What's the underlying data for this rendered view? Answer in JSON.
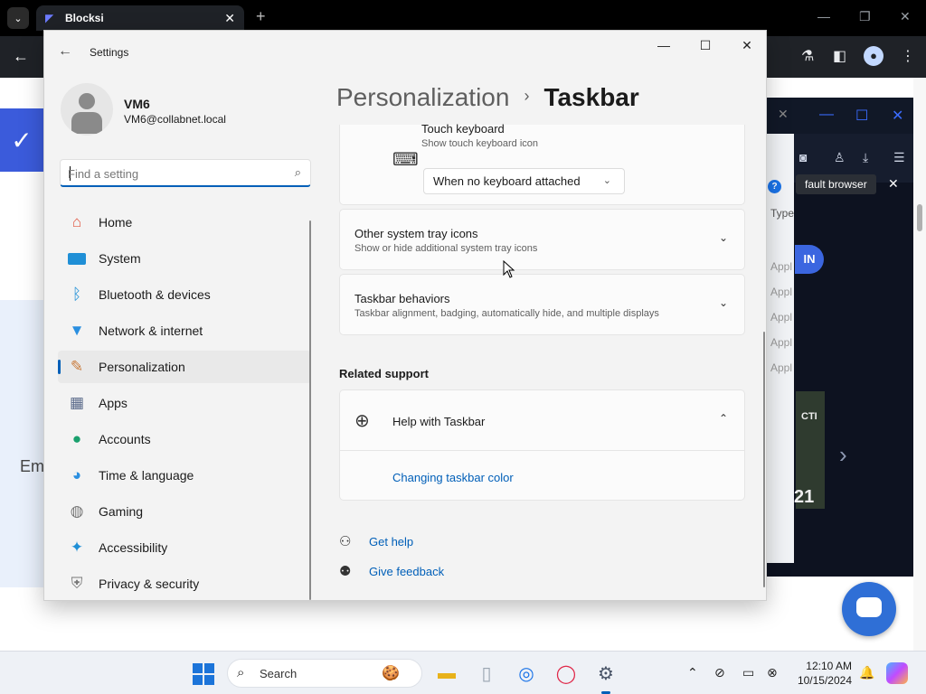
{
  "browser": {
    "tab_title": "Blocksi",
    "tab_close": "✕",
    "new_tab": "+",
    "site_text": "Em",
    "popup": {
      "tooltip": "fault browser",
      "tooltip_close": "✕",
      "type_label": "Type",
      "sign_in_fragment": "IN",
      "list_items": [
        "Appl",
        "Appl",
        "Appl",
        "Appl",
        "Appl"
      ],
      "promo_number": "21",
      "promo_text": "CTI"
    }
  },
  "settings": {
    "app_title": "Settings",
    "user": {
      "name": "VM6",
      "email": "VM6@collabnet.local"
    },
    "search": {
      "placeholder": "Find a setting"
    },
    "nav": [
      {
        "label": "Home",
        "icon": "home-icon",
        "glyph": "🏠",
        "color": "#e1553f"
      },
      {
        "label": "System",
        "icon": "system-icon",
        "glyph": "▬",
        "color": "#1f8fd6"
      },
      {
        "label": "Bluetooth & devices",
        "icon": "bluetooth-icon",
        "glyph": "✱",
        "color": "#1f8fd6"
      },
      {
        "label": "Network & internet",
        "icon": "wifi-icon",
        "glyph": "◆",
        "color": "#2a8fe0"
      },
      {
        "label": "Personalization",
        "icon": "brush-icon",
        "glyph": "🖌",
        "color": "#c97a3a"
      },
      {
        "label": "Apps",
        "icon": "apps-icon",
        "glyph": "▦",
        "color": "#5a6a8a"
      },
      {
        "label": "Accounts",
        "icon": "accounts-icon",
        "glyph": "●",
        "color": "#1aa06d"
      },
      {
        "label": "Time & language",
        "icon": "globe-clock-icon",
        "glyph": "◕",
        "color": "#2a8fe0"
      },
      {
        "label": "Gaming",
        "icon": "gamepad-icon",
        "glyph": "🎮",
        "color": "#777777"
      },
      {
        "label": "Accessibility",
        "icon": "accessibility-icon",
        "glyph": "✦",
        "color": "#1f8fd6"
      },
      {
        "label": "Privacy & security",
        "icon": "shield-icon",
        "glyph": "⛨",
        "color": "#777777"
      }
    ],
    "active_nav": "Personalization",
    "breadcrumb": {
      "parent": "Personalization",
      "separator": "›",
      "current": "Taskbar"
    },
    "touch_keyboard": {
      "title": "Touch keyboard",
      "subtitle": "Show touch keyboard icon",
      "dropdown_value": "When no keyboard attached"
    },
    "other_tray": {
      "title": "Other system tray icons",
      "subtitle": "Show or hide additional system tray icons"
    },
    "behaviors": {
      "title": "Taskbar behaviors",
      "subtitle": "Taskbar alignment, badging, automatically hide, and multiple displays"
    },
    "related_support": {
      "heading": "Related support",
      "help_title": "Help with Taskbar",
      "link": "Changing taskbar color"
    },
    "footer": {
      "get_help": "Get help",
      "give_feedback": "Give feedback"
    }
  },
  "taskbar": {
    "search_label": "Search",
    "time": "12:10 AM",
    "date": "10/15/2024"
  },
  "colors": {
    "accent": "#005fb8",
    "window_bg": "#f3f3f3",
    "card_bg": "#fbfbfb"
  }
}
